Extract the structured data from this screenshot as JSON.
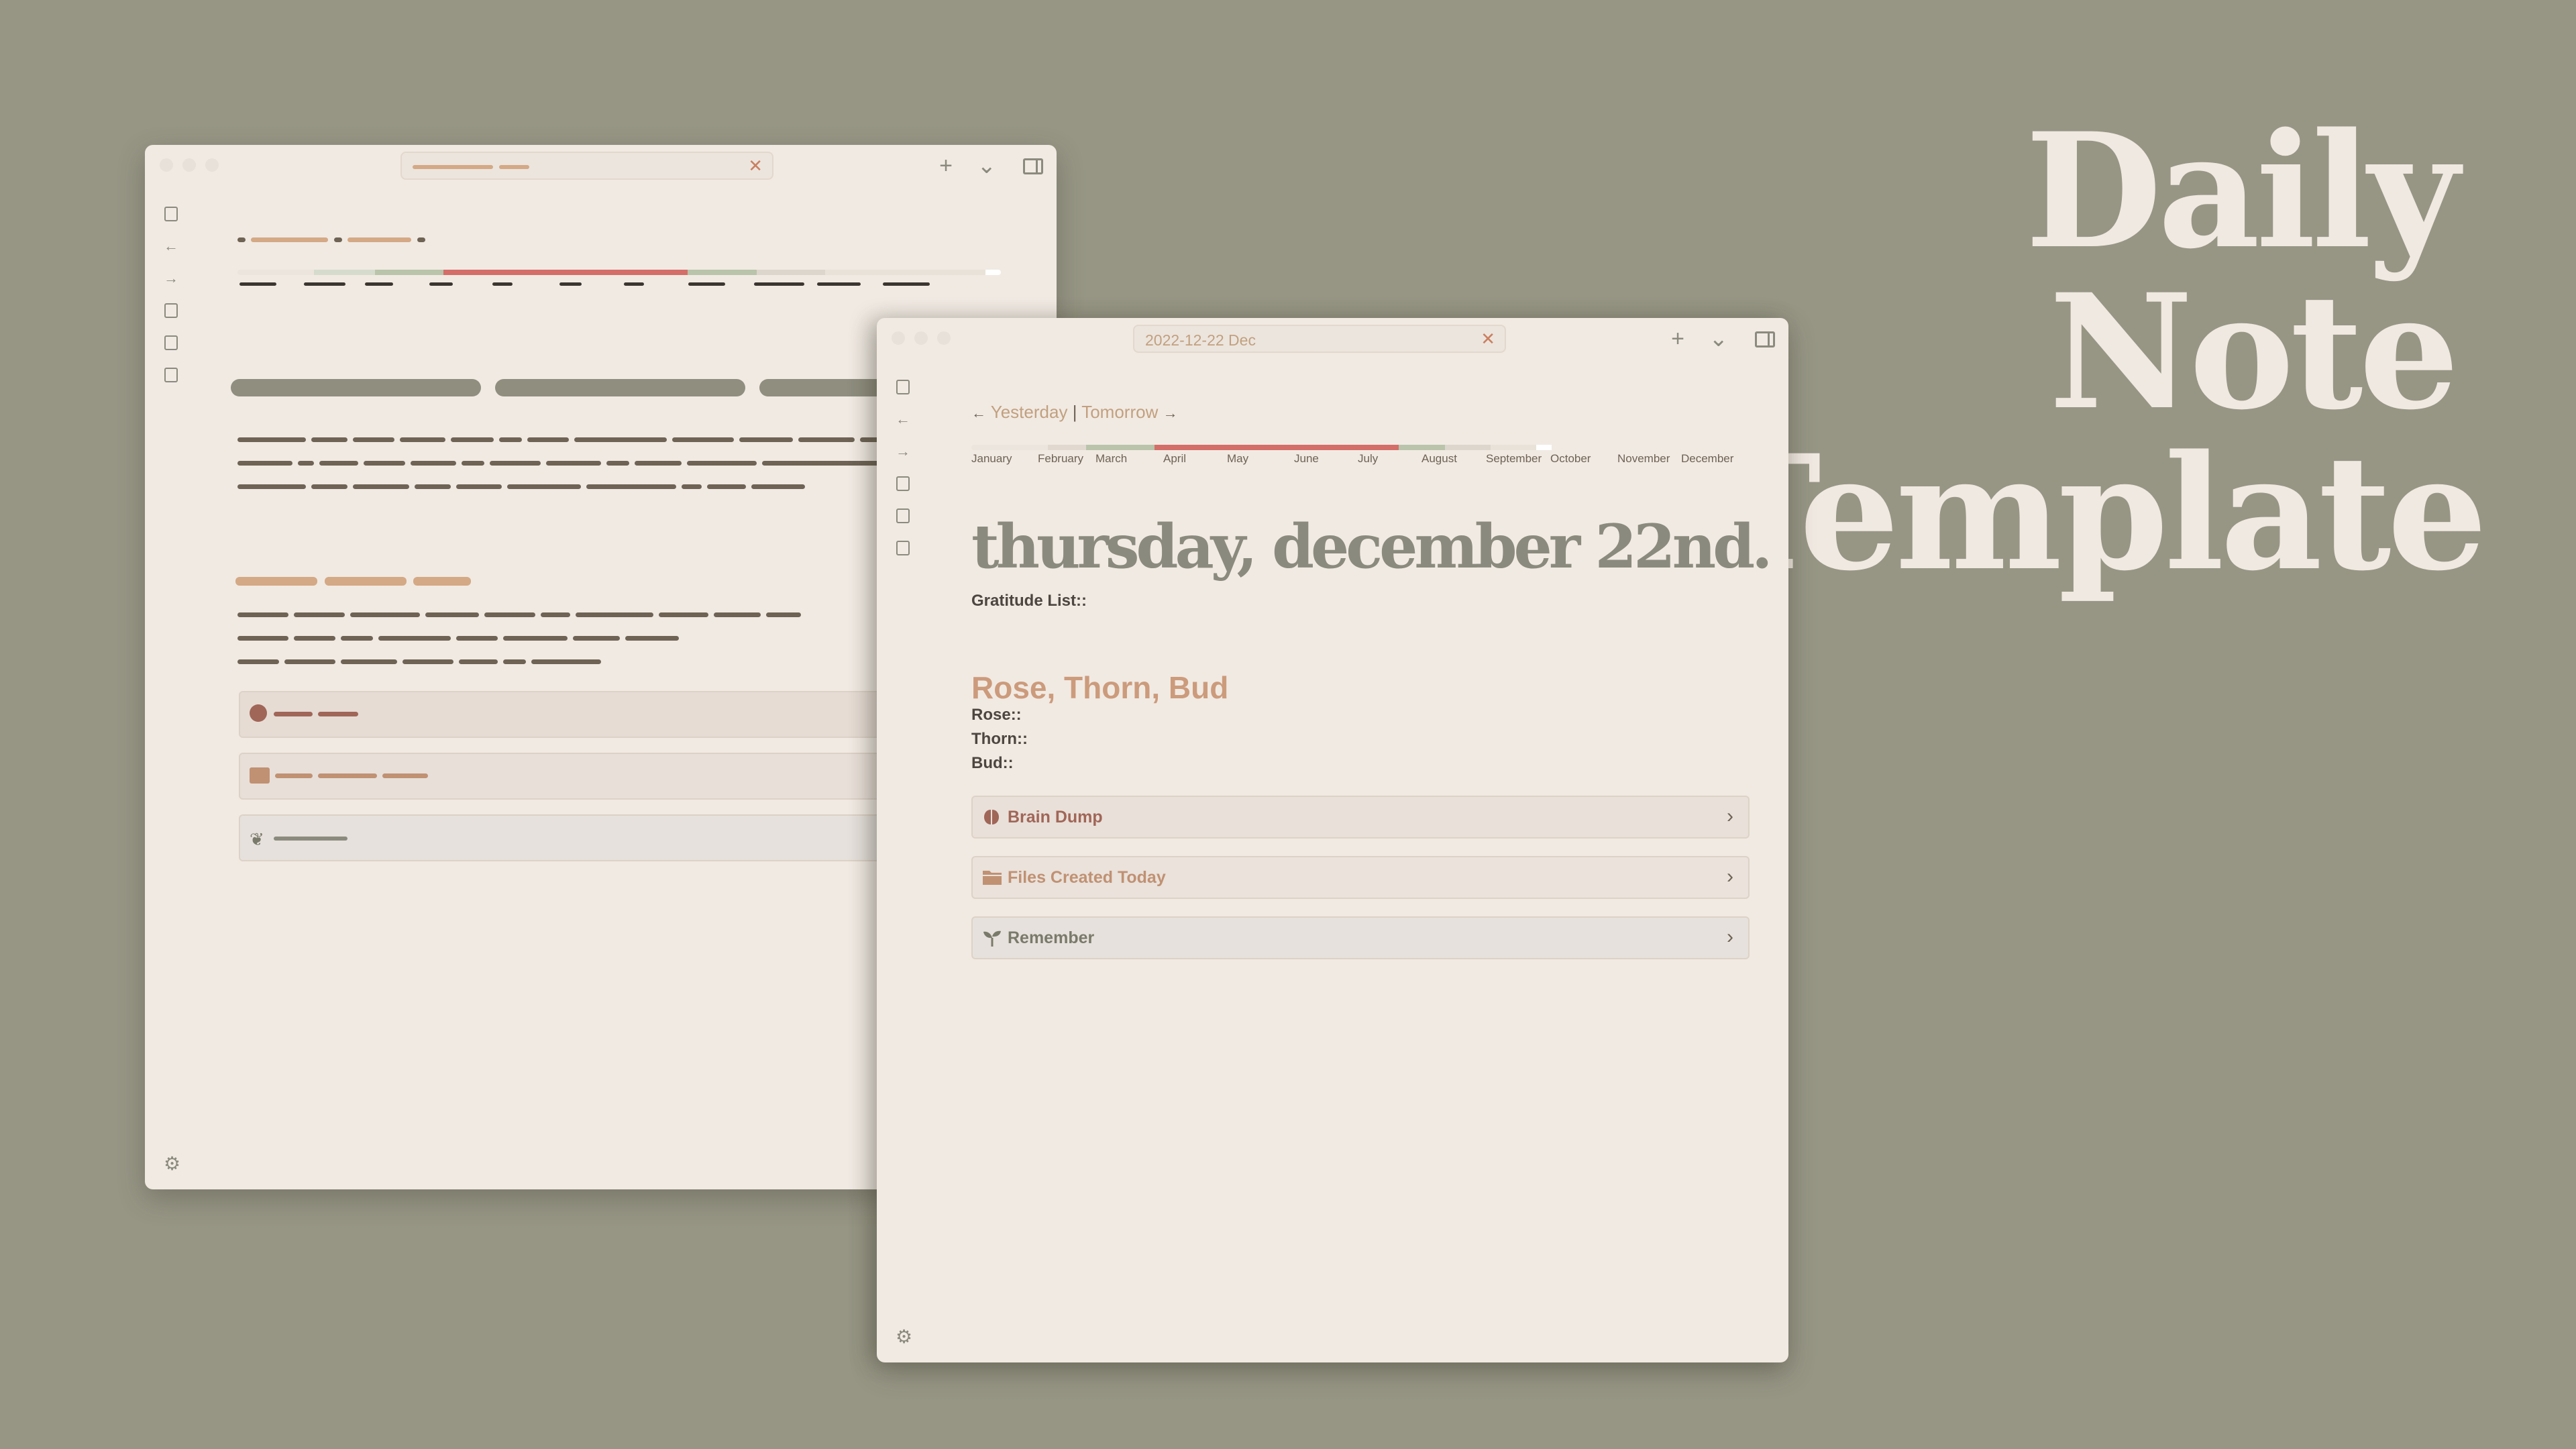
{
  "headline": {
    "line1": "Daily Note",
    "line2": "Template"
  },
  "front": {
    "tab_title": "2022-12-22 Dec",
    "nav": {
      "yesterday": "Yesterday",
      "separator": "|",
      "tomorrow": "Tomorrow",
      "left_arrow": "←",
      "right_arrow": "→"
    },
    "months": [
      "January",
      "February",
      "March",
      "April",
      "May",
      "June",
      "July",
      "August",
      "September",
      "October",
      "November",
      "December"
    ],
    "year_progress_segments": [
      {
        "color": "#ece5de",
        "share": 0.1
      },
      {
        "color": "#e1d9cf",
        "share": 0.05
      },
      {
        "color": "#b9c4ab",
        "share": 0.09
      },
      {
        "color": "#d46e68",
        "share": 0.32
      },
      {
        "color": "#b9c4ab",
        "share": 0.06
      },
      {
        "color": "#ddd6cc",
        "share": 0.06
      },
      {
        "color": "#e8e2d9",
        "share": 0.06
      },
      {
        "color": "#ffffff",
        "share": 0.02
      }
    ],
    "date_title": "thursday, december 22nd.",
    "gratitude_label": "Gratitude List::",
    "section_heading": "Rose, Thorn, Bud",
    "rose_label": "Rose::",
    "thorn_label": "Thorn::",
    "bud_label": "Bud::",
    "callouts": [
      {
        "label": "Brain Dump",
        "icon": "brain-icon",
        "color": "#a06658",
        "bg": "#e9e0d9"
      },
      {
        "label": "Files Created Today",
        "icon": "folder-icon",
        "color": "#c09173",
        "bg": "#eae2db"
      },
      {
        "label": "Remember",
        "icon": "sprout-icon",
        "color": "#7a7a6b",
        "bg": "#e6e1dc"
      }
    ]
  },
  "colors": {
    "background": "#979685",
    "window": "#f1eae3",
    "accent": "#cc9b7c",
    "title_gray": "#8b8a7e"
  }
}
